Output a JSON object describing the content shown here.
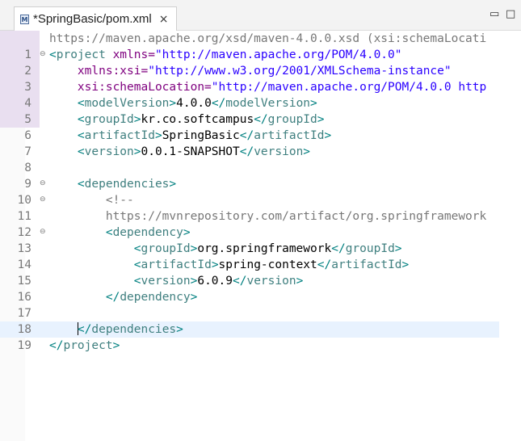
{
  "tab": {
    "title": "*SpringBasic/pom.xml",
    "icon": "M",
    "close": "×"
  },
  "window": {
    "minimize": "▭",
    "maximize": "□"
  },
  "editor": {
    "wrapped_line": "https://maven.apache.org/xsd/maven-4.0.0.xsd (xsi:schemaLocati",
    "lines": [
      {
        "num": "1",
        "fold": "⊖",
        "changed": true,
        "current": false,
        "segs": [
          {
            "t": "<",
            "c": "brk"
          },
          {
            "t": "project",
            "c": "tag"
          },
          {
            "t": " xmlns=",
            "c": "attr"
          },
          {
            "t": "\"http://maven.apache.org/POM/4.0.0\"",
            "c": "val"
          }
        ]
      },
      {
        "num": "2",
        "fold": "",
        "changed": true,
        "current": false,
        "segs": [
          {
            "t": "    ",
            "c": "txt"
          },
          {
            "t": "xmlns:xsi=",
            "c": "attr"
          },
          {
            "t": "\"http://www.w3.org/2001/XMLSchema-instance\"",
            "c": "val"
          }
        ]
      },
      {
        "num": "3",
        "fold": "",
        "changed": true,
        "current": false,
        "segs": [
          {
            "t": "    ",
            "c": "txt"
          },
          {
            "t": "xsi:schemaLocation=",
            "c": "attr"
          },
          {
            "t": "\"http://maven.apache.org/POM/4.0.0 http",
            "c": "val"
          }
        ]
      },
      {
        "num": "4",
        "fold": "",
        "changed": true,
        "current": false,
        "segs": [
          {
            "t": "    ",
            "c": "txt"
          },
          {
            "t": "<",
            "c": "brk"
          },
          {
            "t": "modelVersion",
            "c": "tag"
          },
          {
            "t": ">",
            "c": "brk"
          },
          {
            "t": "4.0.0",
            "c": "txt"
          },
          {
            "t": "</",
            "c": "brk"
          },
          {
            "t": "modelVersion",
            "c": "tag"
          },
          {
            "t": ">",
            "c": "brk"
          }
        ]
      },
      {
        "num": "5",
        "fold": "",
        "changed": true,
        "current": false,
        "segs": [
          {
            "t": "    ",
            "c": "txt"
          },
          {
            "t": "<",
            "c": "brk"
          },
          {
            "t": "groupId",
            "c": "tag"
          },
          {
            "t": ">",
            "c": "brk"
          },
          {
            "t": "kr.co.softcampus",
            "c": "txt"
          },
          {
            "t": "</",
            "c": "brk"
          },
          {
            "t": "groupId",
            "c": "tag"
          },
          {
            "t": ">",
            "c": "brk"
          }
        ]
      },
      {
        "num": "6",
        "fold": "",
        "changed": false,
        "current": false,
        "segs": [
          {
            "t": "    ",
            "c": "txt"
          },
          {
            "t": "<",
            "c": "brk"
          },
          {
            "t": "artifactId",
            "c": "tag"
          },
          {
            "t": ">",
            "c": "brk"
          },
          {
            "t": "SpringBasic",
            "c": "txt"
          },
          {
            "t": "</",
            "c": "brk"
          },
          {
            "t": "artifactId",
            "c": "tag"
          },
          {
            "t": ">",
            "c": "brk"
          }
        ]
      },
      {
        "num": "7",
        "fold": "",
        "changed": false,
        "current": false,
        "segs": [
          {
            "t": "    ",
            "c": "txt"
          },
          {
            "t": "<",
            "c": "brk"
          },
          {
            "t": "version",
            "c": "tag"
          },
          {
            "t": ">",
            "c": "brk"
          },
          {
            "t": "0.0.1-SNAPSHOT",
            "c": "txt"
          },
          {
            "t": "</",
            "c": "brk"
          },
          {
            "t": "version",
            "c": "tag"
          },
          {
            "t": ">",
            "c": "brk"
          }
        ]
      },
      {
        "num": "8",
        "fold": "",
        "changed": false,
        "current": false,
        "segs": []
      },
      {
        "num": "9",
        "fold": "⊖",
        "changed": false,
        "current": false,
        "segs": [
          {
            "t": "    ",
            "c": "txt"
          },
          {
            "t": "<",
            "c": "brk"
          },
          {
            "t": "dependencies",
            "c": "tag"
          },
          {
            "t": ">",
            "c": "brk"
          }
        ]
      },
      {
        "num": "10",
        "fold": "⊖",
        "changed": false,
        "current": false,
        "segs": [
          {
            "t": "        ",
            "c": "txt"
          },
          {
            "t": "<!--",
            "c": "dim"
          }
        ]
      },
      {
        "num": "11",
        "fold": "",
        "changed": false,
        "current": false,
        "segs": [
          {
            "t": "        ",
            "c": "txt"
          },
          {
            "t": "https://mvnrepository.com/artifact/org.springframework",
            "c": "dim"
          }
        ]
      },
      {
        "num": "12",
        "fold": "⊖",
        "changed": false,
        "current": false,
        "segs": [
          {
            "t": "        ",
            "c": "txt"
          },
          {
            "t": "<",
            "c": "brk"
          },
          {
            "t": "dependency",
            "c": "tag"
          },
          {
            "t": ">",
            "c": "brk"
          }
        ]
      },
      {
        "num": "13",
        "fold": "",
        "changed": false,
        "current": false,
        "segs": [
          {
            "t": "            ",
            "c": "txt"
          },
          {
            "t": "<",
            "c": "brk"
          },
          {
            "t": "groupId",
            "c": "tag"
          },
          {
            "t": ">",
            "c": "brk"
          },
          {
            "t": "org.springframework",
            "c": "txt"
          },
          {
            "t": "</",
            "c": "brk"
          },
          {
            "t": "groupId",
            "c": "tag"
          },
          {
            "t": ">",
            "c": "brk"
          }
        ]
      },
      {
        "num": "14",
        "fold": "",
        "changed": false,
        "current": false,
        "segs": [
          {
            "t": "            ",
            "c": "txt"
          },
          {
            "t": "<",
            "c": "brk"
          },
          {
            "t": "artifactId",
            "c": "tag"
          },
          {
            "t": ">",
            "c": "brk"
          },
          {
            "t": "spring-context",
            "c": "txt"
          },
          {
            "t": "</",
            "c": "brk"
          },
          {
            "t": "artifactId",
            "c": "tag"
          },
          {
            "t": ">",
            "c": "brk"
          }
        ]
      },
      {
        "num": "15",
        "fold": "",
        "changed": false,
        "current": false,
        "segs": [
          {
            "t": "            ",
            "c": "txt"
          },
          {
            "t": "<",
            "c": "brk"
          },
          {
            "t": "version",
            "c": "tag"
          },
          {
            "t": ">",
            "c": "brk"
          },
          {
            "t": "6.0.9",
            "c": "txt"
          },
          {
            "t": "</",
            "c": "brk"
          },
          {
            "t": "version",
            "c": "tag"
          },
          {
            "t": ">",
            "c": "brk"
          }
        ]
      },
      {
        "num": "16",
        "fold": "",
        "changed": false,
        "current": false,
        "segs": [
          {
            "t": "        ",
            "c": "txt"
          },
          {
            "t": "</",
            "c": "brk"
          },
          {
            "t": "dependency",
            "c": "tag"
          },
          {
            "t": ">",
            "c": "brk"
          }
        ]
      },
      {
        "num": "17",
        "fold": "",
        "changed": false,
        "current": false,
        "segs": []
      },
      {
        "num": "18",
        "fold": "",
        "changed": false,
        "current": true,
        "segs": [
          {
            "t": "    ",
            "c": "txt"
          },
          {
            "t": "|",
            "c": "caret"
          },
          {
            "t": "</",
            "c": "brk"
          },
          {
            "t": "dependencies",
            "c": "tag"
          },
          {
            "t": ">",
            "c": "brk"
          }
        ]
      },
      {
        "num": "19",
        "fold": "",
        "changed": false,
        "current": false,
        "segs": [
          {
            "t": "</",
            "c": "brk"
          },
          {
            "t": "project",
            "c": "tag"
          },
          {
            "t": ">",
            "c": "brk"
          }
        ]
      }
    ]
  }
}
